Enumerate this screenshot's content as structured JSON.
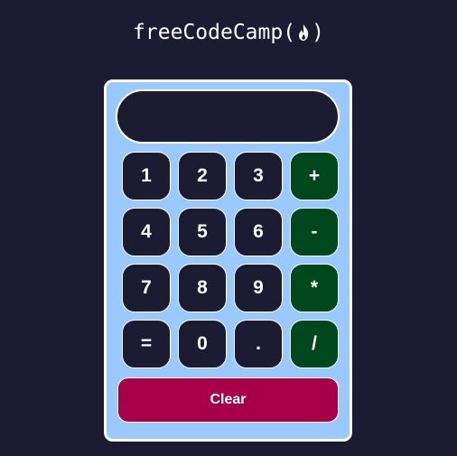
{
  "header": {
    "brand_text": "freeCodeCamp",
    "paren_open": "(",
    "paren_close": ")",
    "logo_icon": "flame-icon"
  },
  "display": {
    "value": ""
  },
  "keys": {
    "k1": "1",
    "k2": "2",
    "k3": "3",
    "plus": "+",
    "k4": "4",
    "k5": "5",
    "k6": "6",
    "minus": "-",
    "k7": "7",
    "k8": "8",
    "k9": "9",
    "multiply": "*",
    "equals": "=",
    "k0": "0",
    "decimal": ".",
    "divide": "/"
  },
  "clear_label": "Clear",
  "colors": {
    "page_background": "#1b1b32",
    "calculator_background": "#99c9ff",
    "number_key": "#1b1b32",
    "operator_key": "#00471b",
    "clear_button": "#a80048",
    "border": "#ffffff"
  }
}
